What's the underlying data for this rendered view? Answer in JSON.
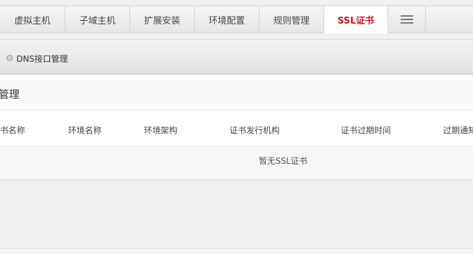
{
  "tabs": [
    {
      "label": "虚拟主机",
      "active": false
    },
    {
      "label": "子域主机",
      "active": false
    },
    {
      "label": "扩展安装",
      "active": false
    },
    {
      "label": "环境配置",
      "active": false
    },
    {
      "label": "规则管理",
      "active": false
    },
    {
      "label": "SSL证书",
      "active": true
    }
  ],
  "toolbar": {
    "dns_label": "DNS接口管理",
    "icon": "gear-icon"
  },
  "panel": {
    "title": "管理",
    "columns": [
      "证书名称",
      "环境名称",
      "环境架构",
      "证书发行机构",
      "证书过期时间",
      "过期通知"
    ],
    "empty_text": "暂无SSL证书"
  },
  "colors": {
    "active_tab": "#c8161d",
    "accent_text": "#333333"
  }
}
